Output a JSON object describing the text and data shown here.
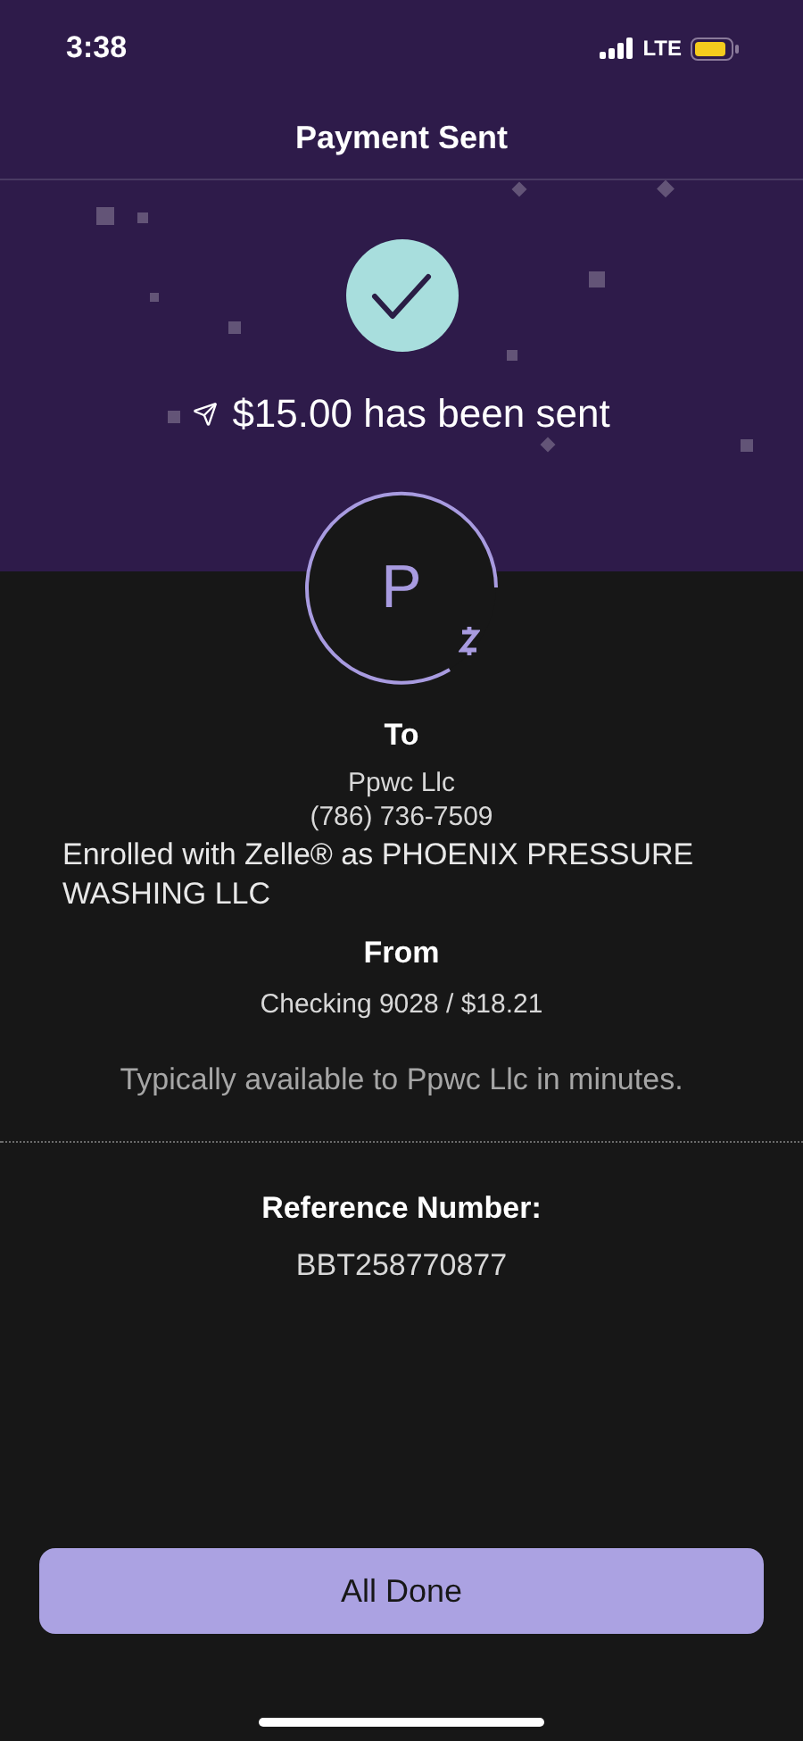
{
  "status_bar": {
    "time": "3:38",
    "network": "LTE"
  },
  "header": {
    "title": "Payment Sent"
  },
  "confirmation": {
    "amount_text": "$15.00 has been sent"
  },
  "recipient": {
    "initial": "P",
    "label": "To",
    "name": "Ppwc Llc",
    "phone": "(786) 736-7509",
    "enrolled": "Enrolled with Zelle® as PHOENIX PRESSURE WASHING LLC"
  },
  "source": {
    "label": "From",
    "account": "Checking 9028 / $18.21"
  },
  "availability": "Typically available to Ppwc Llc in minutes.",
  "reference": {
    "label": "Reference Number:",
    "value": "BBT258770877"
  },
  "buttons": [
    "All Done"
  ]
}
